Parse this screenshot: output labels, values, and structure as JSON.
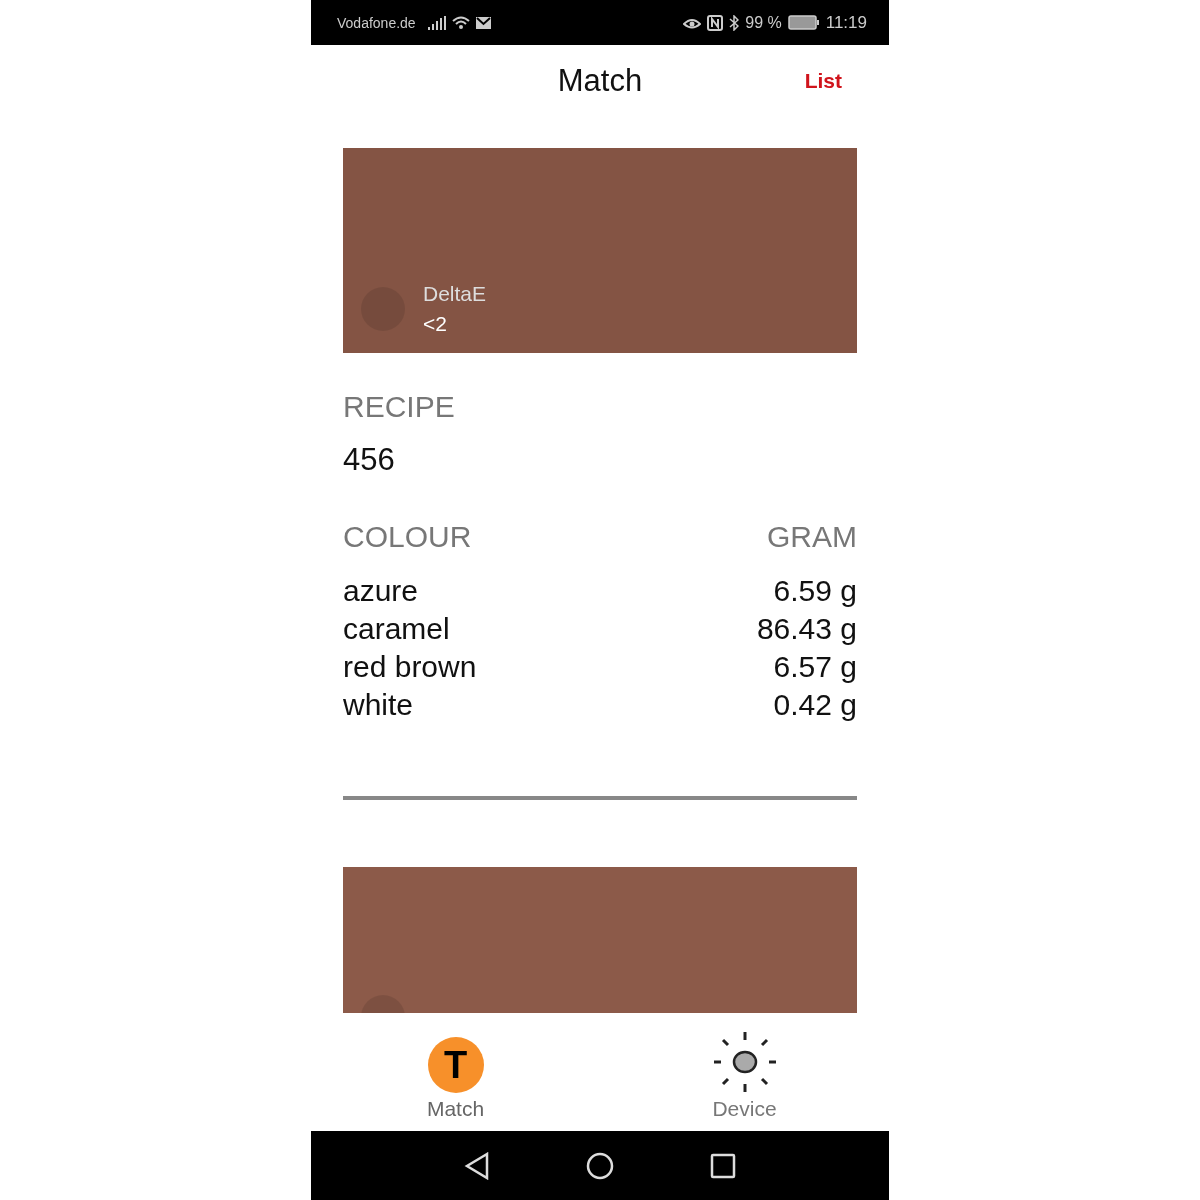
{
  "status_bar": {
    "carrier": "Vodafone.de",
    "battery": "99 %",
    "time": "11:19"
  },
  "header": {
    "title": "Match",
    "action": "List"
  },
  "matches": [
    {
      "color": "#845444",
      "delta_label": "DeltaE",
      "delta_value": "<2",
      "recipe_label": "RECIPE",
      "recipe": "456",
      "colour_heading": "COLOUR",
      "gram_heading": "GRAM",
      "components": [
        {
          "colour": "azure",
          "gram": "6.59 g"
        },
        {
          "colour": "caramel",
          "gram": "86.43 g"
        },
        {
          "colour": "red brown",
          "gram": "6.57 g"
        },
        {
          "colour": "white",
          "gram": "0.42 g"
        }
      ]
    },
    {
      "color": "#8c5a49"
    }
  ],
  "tabs": [
    {
      "kind": "letter",
      "icon_text": "T",
      "label": "Match",
      "selected": true
    },
    {
      "kind": "sun",
      "label": "Device",
      "selected": false
    }
  ]
}
